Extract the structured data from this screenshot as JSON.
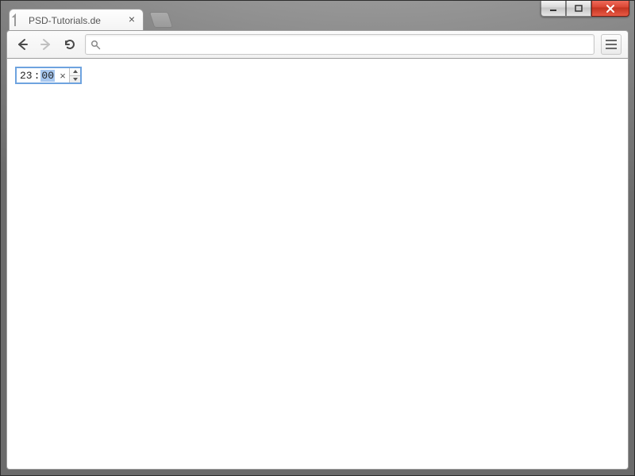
{
  "window": {
    "controls": {
      "minimize": "minimize",
      "maximize": "maximize",
      "close": "close"
    }
  },
  "tab": {
    "title": "PSD-Tutorials.de"
  },
  "toolbar": {
    "back": "Back",
    "forward": "Forward",
    "reload": "Reload",
    "menu": "Menu"
  },
  "omnibox": {
    "value": "",
    "placeholder": ""
  },
  "page": {
    "time_input": {
      "hours": "23",
      "minutes": "00",
      "separator": ":",
      "selected_segment": "minutes",
      "clear_symbol": "×"
    }
  }
}
